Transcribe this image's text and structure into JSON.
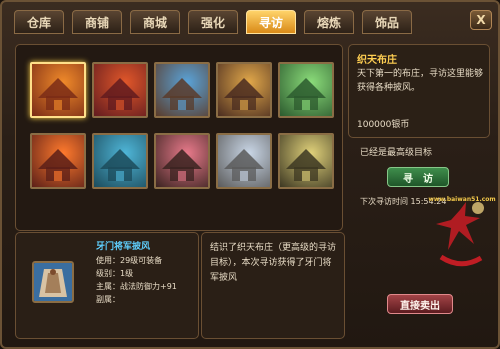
{
  "tabs": [
    "仓库",
    "商铺",
    "商城",
    "强化",
    "寻访",
    "熔炼",
    "饰品"
  ],
  "active_tab_index": 4,
  "close_label": "X",
  "gallery": {
    "slots": [
      {
        "name": "sunset-horses",
        "c1": "#f08a2a",
        "c2": "#7a2b16"
      },
      {
        "name": "fire-sky",
        "c1": "#e1572a",
        "c2": "#611b1f"
      },
      {
        "name": "thatched-hut",
        "c1": "#5aa3d8",
        "c2": "#5a3b2a"
      },
      {
        "name": "dock-house",
        "c1": "#e1a84a",
        "c2": "#4a2c20"
      },
      {
        "name": "weaving-pavilion",
        "c1": "#8bdc7a",
        "c2": "#2c5a2e"
      },
      {
        "name": "fiery-dragon",
        "c1": "#ff7a2d",
        "c2": "#5b1f18"
      },
      {
        "name": "blue-roof-house",
        "c1": "#4fb6d8",
        "c2": "#1c4b5b"
      },
      {
        "name": "pink-tile-house",
        "c1": "#e87a8b",
        "c2": "#3a2320"
      },
      {
        "name": "stone-tower",
        "c1": "#c9d6e6",
        "c2": "#5b5b5b"
      },
      {
        "name": "palace-courtyard",
        "c1": "#e0d17a",
        "c2": "#3c3722"
      }
    ]
  },
  "detail": {
    "title": "织天布庄",
    "desc": "天下第一的布庄，寻访这里能够获得各种披风。",
    "price": "100000银币"
  },
  "max_level_text": "已经是最高级目标",
  "search_button": "寻　访",
  "next_search": "下次寻访时间 15:54:24",
  "watermark_text": "www.baiwan51.com",
  "item": {
    "name": "牙门将军披风",
    "stats": [
      "使用：29级可装备",
      "级别：1级",
      "主属：战法防御力+91",
      "副属："
    ]
  },
  "message": "结识了织天布庄（更高级的寻访目标），本次寻访获得了牙门将军披风",
  "sell_button": "直接卖出"
}
